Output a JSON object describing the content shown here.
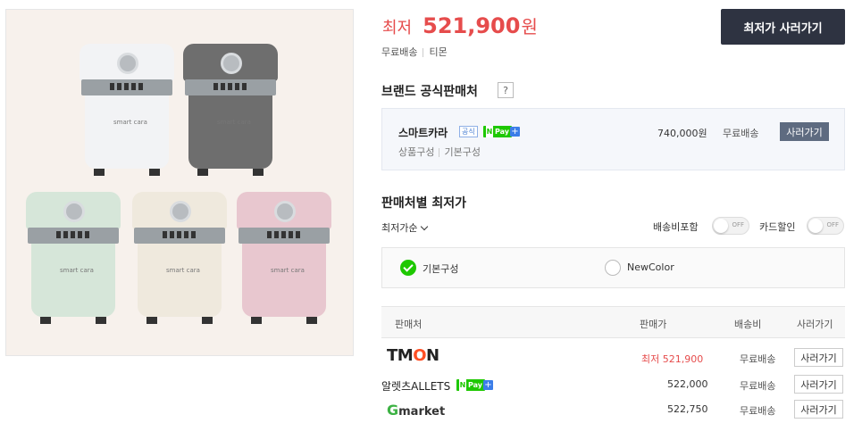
{
  "price": {
    "lowest_label": "최저",
    "value": "521,900",
    "unit": "원",
    "shipping": "무료배송",
    "seller": "티몬",
    "buy_button": "최저가 사러가기"
  },
  "official": {
    "title": "브랜드 공식판매처",
    "help": "?",
    "seller_name": "스마트카라",
    "badge": "공식",
    "npay": "Pay",
    "npay_n": "N",
    "npay_plus": "+",
    "option1": "상품구성",
    "option2": "기본구성",
    "price": "740,000원",
    "shipping": "무료배송",
    "buy_button": "사러가기"
  },
  "sellers_section": {
    "title": "판매처별 최저가",
    "sort_label": "최저가순",
    "toggle1_label": "배송비포함",
    "toggle2_label": "카드할인",
    "toggle_off": "OFF",
    "option_selected": "기본구성",
    "option_other": "NewColor"
  },
  "seller_table": {
    "headers": [
      "판매처",
      "판매가",
      "배송비",
      "사러가기"
    ],
    "rows": [
      {
        "seller": "TMON",
        "price_prefix": "최저",
        "price": "521,900",
        "shipping": "무료배송",
        "button": "사러가기"
      },
      {
        "seller": "알렛츠ALLETS",
        "price": "522,000",
        "shipping": "무료배송",
        "button": "사러가기"
      },
      {
        "seller": "Gmarket",
        "price": "522,750",
        "shipping": "무료배송",
        "button": "사러가기"
      }
    ]
  },
  "product_brand_mark": "smart cara",
  "colors": {
    "accent_red": "#e64c4c",
    "dark_button": "#2e3341",
    "npay_green": "#1ec800"
  }
}
